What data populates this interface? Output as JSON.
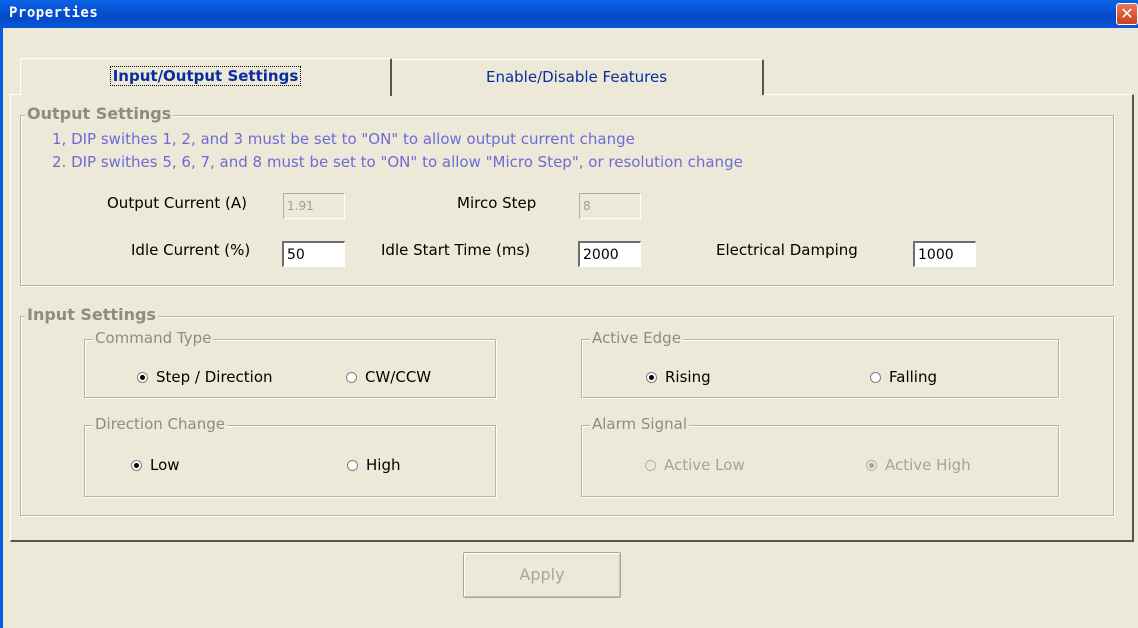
{
  "window": {
    "title": "Properties",
    "close_icon": "close-icon"
  },
  "tabs": [
    {
      "label": "Input/Output Settings",
      "active": true
    },
    {
      "label": "Enable/Disable Features",
      "active": false
    }
  ],
  "output_settings": {
    "title": "Output Settings",
    "notes": [
      "1,  DIP swithes 1, 2, and 3 must be set to \"ON\" to allow output current change",
      "2.  DIP swithes 5, 6, 7, and 8 must be  set to \"ON\" to allow \"Micro Step\", or resolution change"
    ],
    "output_current": {
      "label": "Output Current (A)",
      "value": "1.91"
    },
    "micro_step": {
      "label": "Mirco Step",
      "value": "8"
    },
    "idle_current": {
      "label": "Idle Current (%)",
      "value": "50"
    },
    "idle_start_time": {
      "label": "Idle Start Time (ms)",
      "value": "2000"
    },
    "electrical_damping": {
      "label": "Electrical Damping",
      "value": "1000"
    }
  },
  "input_settings": {
    "title": "Input Settings",
    "command_type": {
      "title": "Command Type",
      "options": [
        "Step / Direction",
        "CW/CCW"
      ],
      "selected": "Step / Direction"
    },
    "active_edge": {
      "title": "Active Edge",
      "options": [
        "Rising",
        "Falling"
      ],
      "selected": "Rising"
    },
    "direction_change": {
      "title": "Direction Change",
      "options": [
        "Low",
        "High"
      ],
      "selected": "Low"
    },
    "alarm_signal": {
      "title": "Alarm Signal",
      "options": [
        "Active Low",
        "Active High"
      ],
      "selected": "Active High"
    }
  },
  "apply_button": {
    "label": "Apply"
  },
  "colors": {
    "titlebar": "#0A5BDC",
    "note_text": "#6E6BD8",
    "tab_text": "#0A2D9E",
    "face": "#ECE9D8"
  }
}
